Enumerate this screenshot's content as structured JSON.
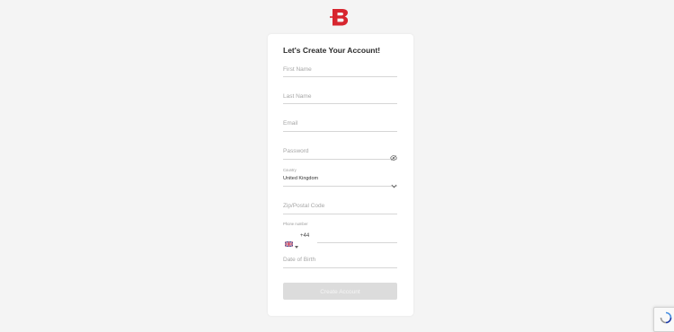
{
  "brand": {
    "logo_icon": "brand-b-logo-icon",
    "accent": "#d7262f"
  },
  "form": {
    "title": "Let's Create Your Account!",
    "first_name_placeholder": "First Name",
    "last_name_placeholder": "Last Name",
    "email_placeholder": "Email",
    "password_placeholder": "Password",
    "country_label": "Country",
    "country_value": "United Kingdom",
    "zip_placeholder": "Zip/Postal Code",
    "phone_label": "Phone number",
    "phone_code": "+44",
    "dob_placeholder": "Date of Birth",
    "submit_label": "Create Account"
  },
  "icons": {
    "password_toggle": "eye-off-icon",
    "country_dropdown": "chevron-down-icon",
    "flag": "uk-flag-icon",
    "recaptcha": "recaptcha-icon"
  }
}
